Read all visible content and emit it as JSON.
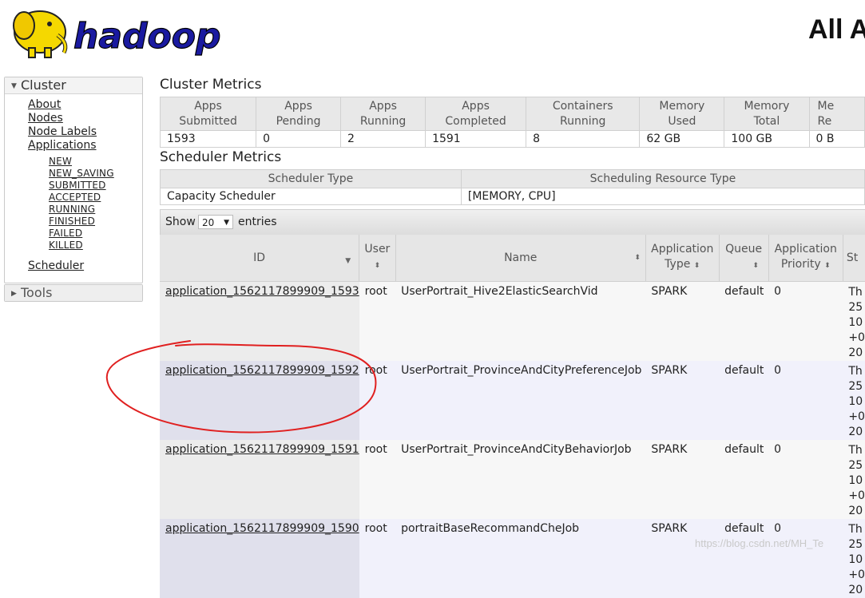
{
  "header": {
    "logo_text": "hadoop",
    "title": "All A"
  },
  "sidebar": {
    "cluster_label": "Cluster",
    "links": [
      "About",
      "Nodes",
      "Node Labels",
      "Applications"
    ],
    "app_states": [
      "NEW",
      "NEW_SAVING",
      "SUBMITTED",
      "ACCEPTED",
      "RUNNING",
      "FINISHED",
      "FAILED",
      "KILLED"
    ],
    "scheduler_label": "Scheduler",
    "tools_label": "Tools"
  },
  "cluster_metrics": {
    "title": "Cluster Metrics",
    "headers": [
      "Apps\nSubmitted",
      "Apps\nPending",
      "Apps\nRunning",
      "Apps\nCompleted",
      "Containers\nRunning",
      "Memory\nUsed",
      "Memory\nTotal",
      "Me\nRe"
    ],
    "values": [
      "1593",
      "0",
      "2",
      "1591",
      "8",
      "62 GB",
      "100 GB",
      "0 B"
    ]
  },
  "scheduler_metrics": {
    "title": "Scheduler Metrics",
    "headers": [
      "Scheduler Type",
      "Scheduling Resource Type"
    ],
    "values": [
      "Capacity Scheduler",
      "[MEMORY, CPU]"
    ]
  },
  "table_controls": {
    "show_label": "Show",
    "entries_value": "20",
    "entries_label": "entries"
  },
  "apps_table": {
    "headers": [
      "ID",
      "User",
      "Name",
      "Application\nType",
      "Queue",
      "Application\nPriority",
      "St"
    ],
    "rows": [
      {
        "id": "application_1562117899909_1593",
        "user": "root",
        "name": "UserPortrait_Hive2ElasticSearchVid",
        "type": "SPARK",
        "queue": "default",
        "priority": "0",
        "start": [
          "Th",
          "25",
          "10",
          "+0",
          "20"
        ]
      },
      {
        "id": "application_1562117899909_1592",
        "user": "root",
        "name": "UserPortrait_ProvinceAndCityPreferenceJob",
        "type": "SPARK",
        "queue": "default",
        "priority": "0",
        "start": [
          "Th",
          "25",
          "10",
          "+0",
          "20"
        ]
      },
      {
        "id": "application_1562117899909_1591",
        "user": "root",
        "name": "UserPortrait_ProvinceAndCityBehaviorJob",
        "type": "SPARK",
        "queue": "default",
        "priority": "0",
        "start": [
          "Th",
          "25",
          "10",
          "+0",
          "20"
        ]
      },
      {
        "id": "application_1562117899909_1590",
        "user": "root",
        "name": "portraitBaseRecommandCheJob",
        "type": "SPARK",
        "queue": "default",
        "priority": "0",
        "start": [
          "Th",
          "25",
          "10",
          "+0",
          "20"
        ]
      }
    ]
  },
  "colors": {
    "annotation": "#e02020",
    "logo_blue": "#1a1aa0",
    "logo_yellow": "#f5d800"
  },
  "watermark": "https://blog.csdn.net/MH_Te"
}
